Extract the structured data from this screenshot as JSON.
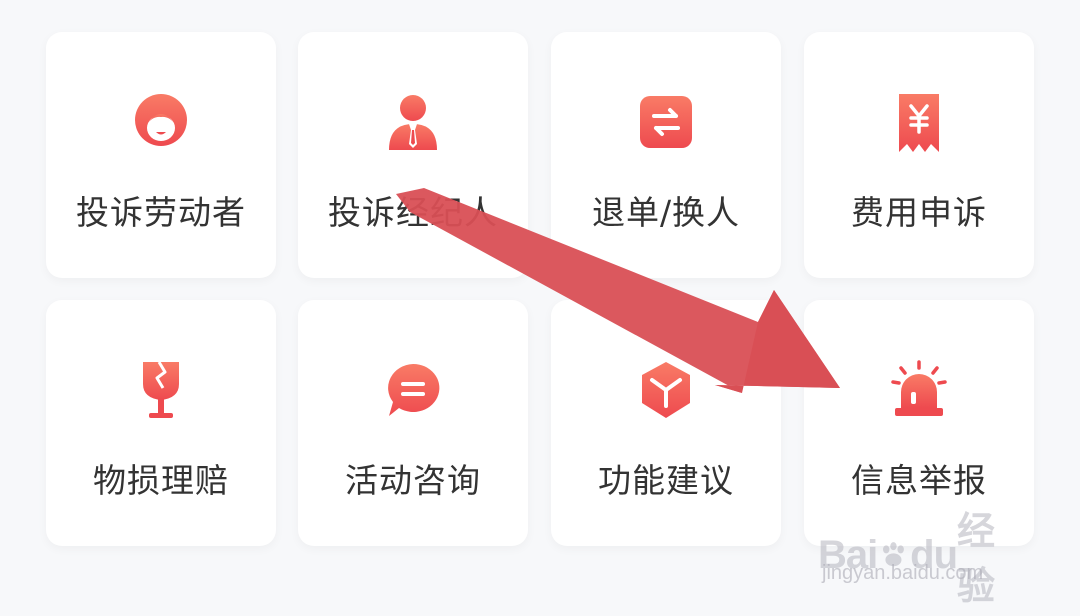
{
  "colors": {
    "accent_start": "#f97b66",
    "accent_end": "#ee4a4f",
    "arrow": "#d94f55",
    "label_text": "#333333"
  },
  "services": [
    {
      "label": "投诉劳动者",
      "icon": "worker-avatar-icon"
    },
    {
      "label": "投诉经纪人",
      "icon": "agent-avatar-icon"
    },
    {
      "label": "退单/换人",
      "icon": "exchange-icon"
    },
    {
      "label": "费用申诉",
      "icon": "yuan-receipt-icon"
    },
    {
      "label": "物损理赔",
      "icon": "broken-glass-icon"
    },
    {
      "label": "活动咨询",
      "icon": "chat-bubble-icon"
    },
    {
      "label": "功能建议",
      "icon": "cube-icon"
    },
    {
      "label": "信息举报",
      "icon": "alarm-light-icon"
    }
  ],
  "watermark": {
    "brand_left": "Bai",
    "brand_right": "du",
    "sub": "经验",
    "url": "jingyan.baidu.com"
  }
}
